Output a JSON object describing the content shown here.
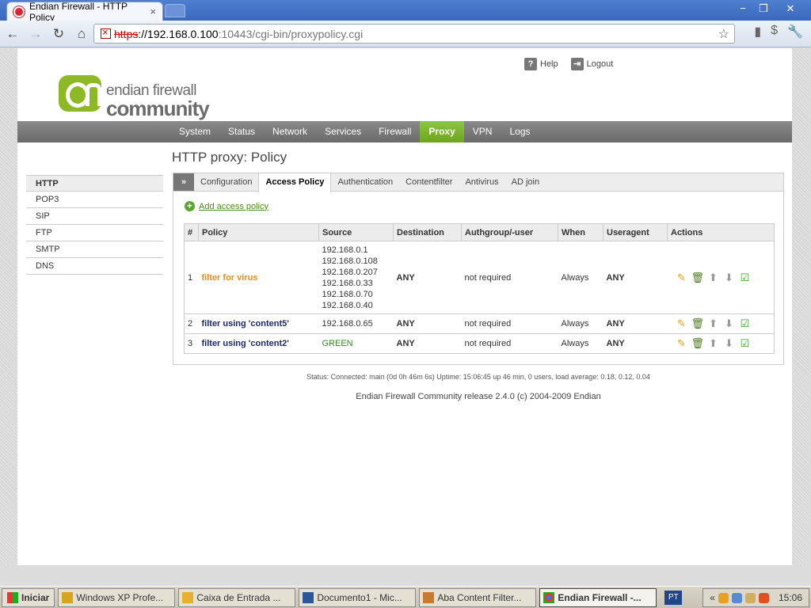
{
  "browser": {
    "tab_title": "Endian Firewall - HTTP Policy",
    "tab_close": "×",
    "url_scheme": "https",
    "url_host": "://192.168.0.100",
    "url_path": ":10443/cgi-bin/proxypolicy.cgi",
    "window_buttons": [
      "−",
      "❐",
      "✕"
    ]
  },
  "header": {
    "logo_line1": "endian firewall",
    "logo_line2": "community",
    "help_label": "Help",
    "logout_label": "Logout"
  },
  "menu": {
    "items": [
      {
        "label": "System"
      },
      {
        "label": "Status"
      },
      {
        "label": "Network"
      },
      {
        "label": "Services"
      },
      {
        "label": "Firewall"
      },
      {
        "label": "Proxy"
      },
      {
        "label": "VPN"
      },
      {
        "label": "Logs"
      }
    ],
    "active": "Proxy"
  },
  "sidebar": {
    "items": [
      {
        "label": "HTTP"
      },
      {
        "label": "POP3"
      },
      {
        "label": "SIP"
      },
      {
        "label": "FTP"
      },
      {
        "label": "SMTP"
      },
      {
        "label": "DNS"
      }
    ],
    "active": "HTTP"
  },
  "page": {
    "title": "HTTP proxy: Policy",
    "tabs_expand": "»",
    "tabs": [
      {
        "label": "Configuration"
      },
      {
        "label": "Access Policy"
      },
      {
        "label": "Authentication"
      },
      {
        "label": "Contentfilter"
      },
      {
        "label": "Antivirus"
      },
      {
        "label": "AD join"
      }
    ],
    "active_tab": "Access Policy",
    "add_link": "Add access policy"
  },
  "table": {
    "headers": [
      "#",
      "Policy",
      "Source",
      "Destination",
      "Authgroup/-user",
      "When",
      "Useragent",
      "Actions"
    ],
    "rows": [
      {
        "num": "1",
        "policy": "filter for virus",
        "policy_color": "#e8901a",
        "source": [
          "192.168.0.1",
          "192.168.0.108",
          "192.168.0.207",
          "192.168.0.33",
          "192.168.0.70",
          "192.168.0.40"
        ],
        "source_color": "#333333",
        "destination": "ANY",
        "auth": "not required",
        "when": "Always",
        "useragent": "ANY"
      },
      {
        "num": "2",
        "policy": "filter using 'content5'",
        "policy_color": "#1c2a6b",
        "source": [
          "192.168.0.65"
        ],
        "source_color": "#333333",
        "destination": "ANY",
        "auth": "not required",
        "when": "Always",
        "useragent": "ANY"
      },
      {
        "num": "3",
        "policy": "filter using 'content2'",
        "policy_color": "#1c2a6b",
        "source": [
          "GREEN"
        ],
        "source_color": "#2e8b1e",
        "destination": "ANY",
        "auth": "not required",
        "when": "Always",
        "useragent": "ANY"
      }
    ],
    "action_icons": [
      "edit-icon",
      "delete-icon",
      "move-up-icon",
      "move-down-icon",
      "enabled-check-icon"
    ]
  },
  "status_line": "Status: Connected: main (0d 0h 46m 6s) Uptime: 15:06:45 up 46 min, 0 users, load average: 0.18, 0.12, 0.04",
  "footer": "Endian Firewall Community release 2.4.0 (c) 2004-2009 Endian",
  "taskbar": {
    "start": "Iniciar",
    "tasks": [
      {
        "label": "Windows XP Profe..."
      },
      {
        "label": "Caixa de Entrada ..."
      },
      {
        "label": "Documento1 - Mic..."
      },
      {
        "label": "Aba Content Filter..."
      },
      {
        "label": "Endian Firewall -..."
      }
    ],
    "lang": "PT",
    "clock": "15:06",
    "tray_chevron": "«"
  },
  "colors": {
    "accent_green": "#8cc63f",
    "menu_grey": "#7a7a7a"
  }
}
